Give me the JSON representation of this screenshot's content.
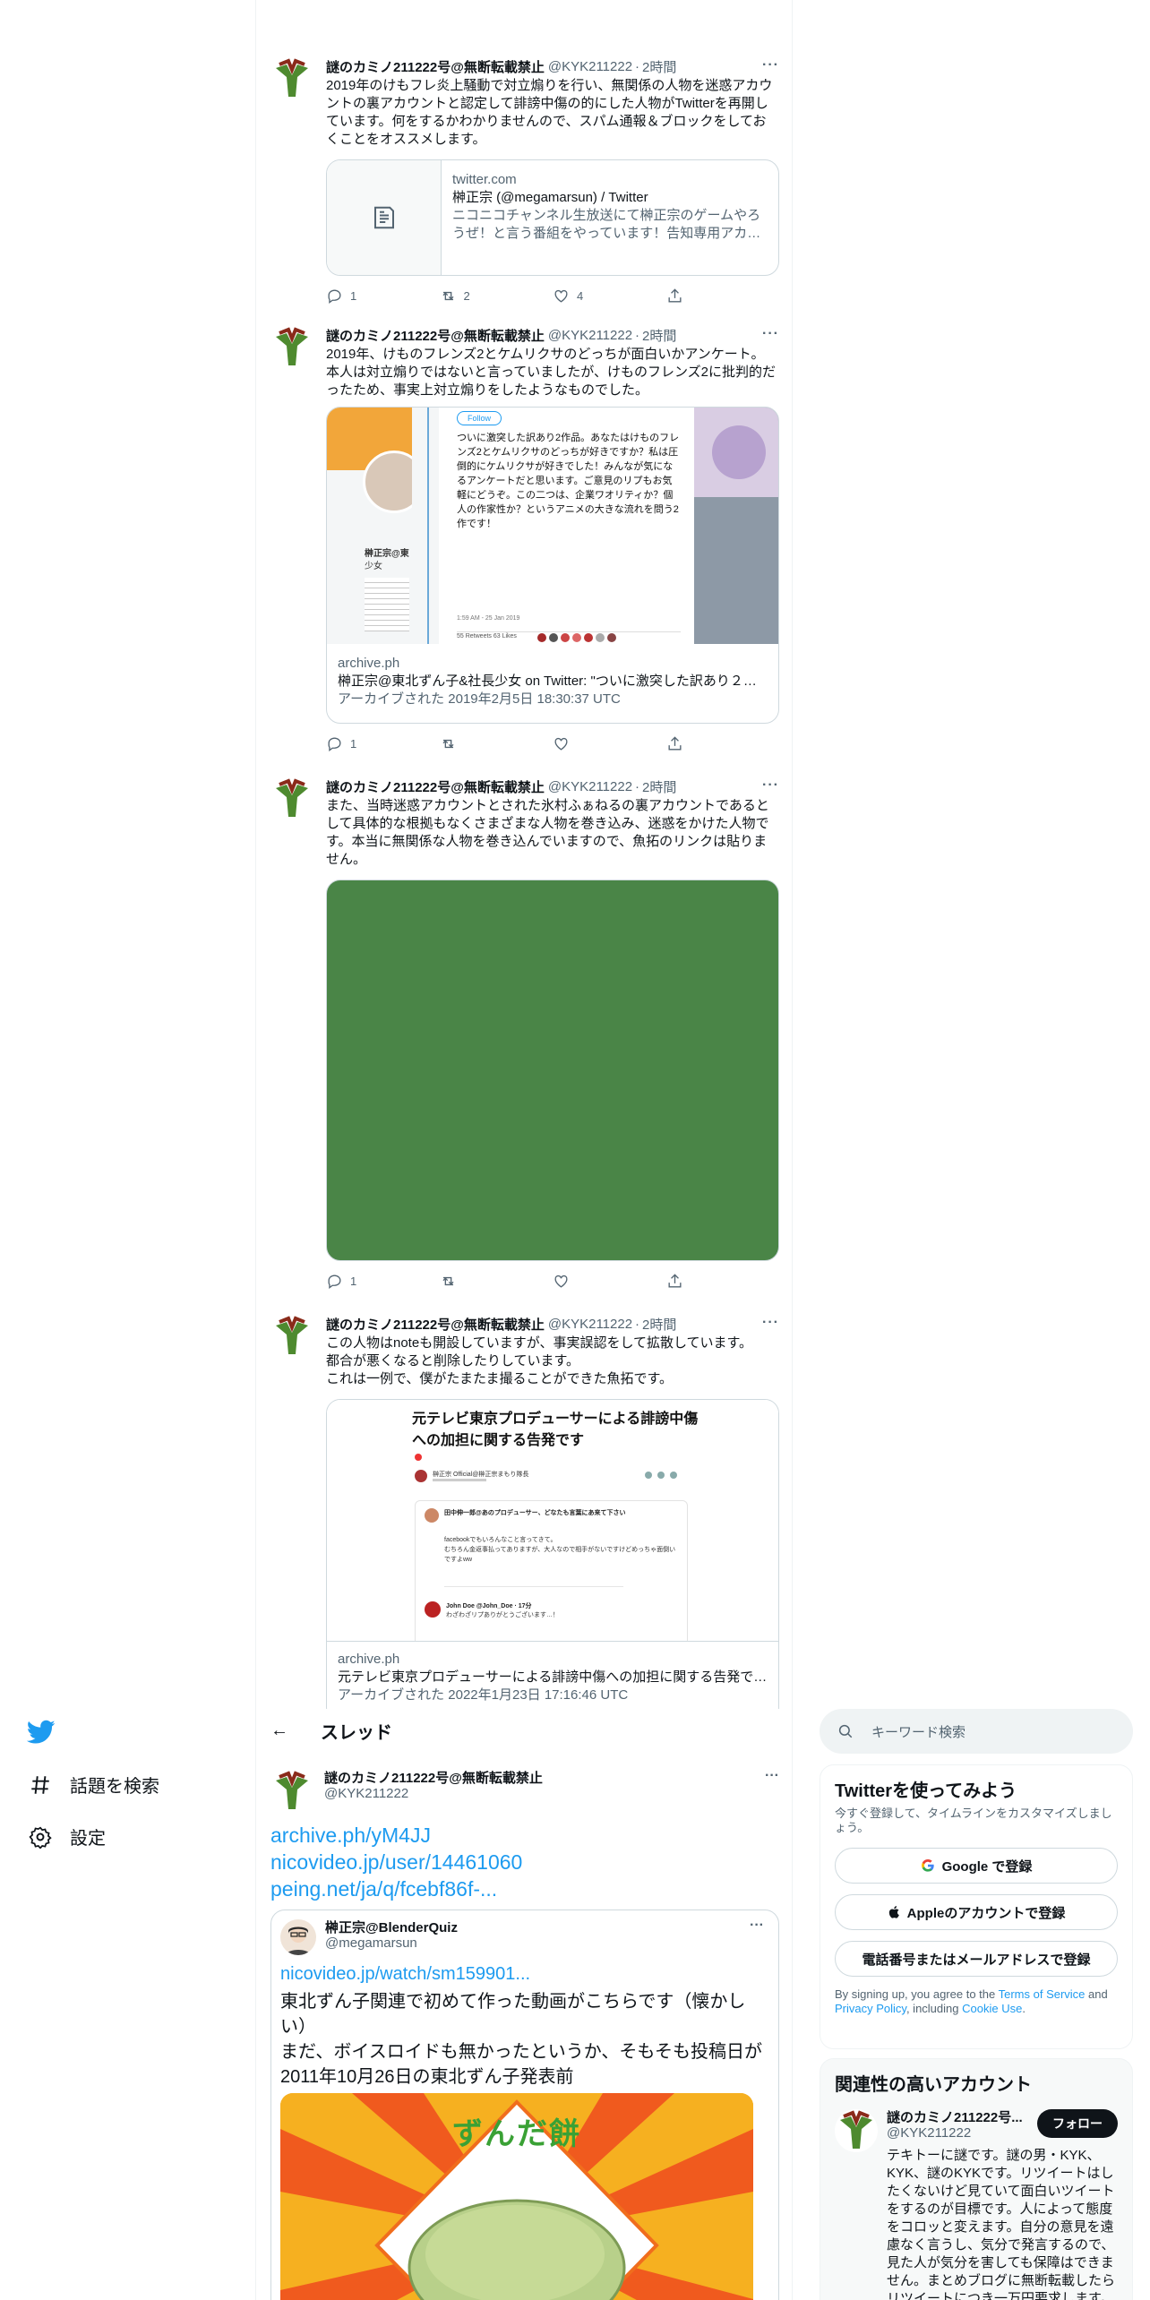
{
  "tweets": [
    {
      "name": "謎のカミノ211222号@無断転載禁止",
      "handle": "@KYK211222",
      "time": "2時間",
      "text": "2019年のけもフレ炎上騒動で対立煽りを行い、無関係の人物を迷惑アカウントの裏アカウントと認定して誹謗中傷の的にした人物がTwitterを再開しています。何をするかわかりませんので、スパム通報＆ブロックをしておくことをオススメします。",
      "card": {
        "domain": "twitter.com",
        "title": "榊正宗 (@megamarsun) / Twitter",
        "desc": "ニコニコチャンネル生放送にて榊正宗のゲームやろうぜ！と言う番組をやっています！告知専用アカウント"
      },
      "actions": {
        "reply": "1",
        "retweet": "2",
        "like": "4"
      }
    },
    {
      "name": "謎のカミノ211222号@無断転載禁止",
      "handle": "@KYK211222",
      "time": "2時間",
      "text": "2019年、けものフレンズ2とケムリクサのどっちが面白いかアンケート。\n本人は対立煽りではないと言っていましたが、けものフレンズ2に批判的だったため、事実上対立煽りをしたようなものでした。",
      "card": {
        "embed_follow": "Follow",
        "embed_text": "ついに激突した訳あり2作品。あなたはけものフレンズ2とケムリクサのどっちが好きですか？私は圧倒的にケムリクサが好きでした！みんなが気になるアンケートだと思います。ご意見のリプもお気軽にどうぞ。この二つは、企業ワオリティか？個人の作家性か？というアニメの大きな流れを問う2作です！",
        "embed_time": "1:59 AM - 25 Jan 2019",
        "embed_stats": "55 Retweets  63 Likes",
        "left_name": "榊正宗@東",
        "left_sub": "少女",
        "domain": "archive.ph",
        "title": "榊正宗@東北ずん子&社長少女 on Twitter: \"ついに激突した訳あり２作品。あなたはけものフレンズ2とケムリクサのどっちが好きですか？",
        "archived": "アーカイブされた 2019年2月5日 18:30:37 UTC"
      },
      "actions": {
        "reply": "1",
        "retweet": "",
        "like": ""
      }
    },
    {
      "name": "謎のカミノ211222号@無断転載禁止",
      "handle": "@KYK211222",
      "time": "2時間",
      "text": "また、当時迷惑アカウントとされた氷村ふぁねるの裏アカウントであるとして具体的な根拠もなくさまざまな人物を巻き込み、迷惑をかけた人物です。本当に無関係な人物を巻き込んでいますので、魚拓のリンクは貼りません。",
      "media_color": "#4a8547",
      "actions": {
        "reply": "1",
        "retweet": "",
        "like": ""
      }
    },
    {
      "name": "謎のカミノ211222号@無断転載禁止",
      "handle": "@KYK211222",
      "time": "2時間",
      "text": "この人物はnoteも開設していますが、事実誤認をして拡散しています。\n都合が悪くなると削除したりしています。\nこれは一例で、僕がたまたま撮ることができた魚拓です。",
      "card": {
        "shot_title": "元テレビ東京プロデューサーによる誹謗中傷への加担に関する告発です",
        "shot_author": "榊正宗 Official@榊正宗まもり隊長",
        "shot_reply_name": "田中伸一郎@あのプロデューサー、どなたも言葉にあ来て下さい",
        "shot_reply_text": "facebookでもいろんなこと言ってきて。\nむちろん金返事払ってありますが、大人なので相手がないですけどめっちゃ面倒いですよww",
        "shot_reply2": "John Doe @John_Doe · 17分",
        "shot_reply2_text": "わざわざリプありがとうございます…！",
        "domain": "archive.ph",
        "title": "元テレビ東京プロデューサーによる誹謗中傷への加担に関する告発です｜榊正宗 Official@",
        "archived": "アーカイブされた 2022年1月23日 17:16:46 UTC"
      }
    }
  ],
  "nav": {
    "explore_label": "話題を検索",
    "settings_label": "設定"
  },
  "header": {
    "back": "←",
    "title": "スレッド"
  },
  "main_tweet": {
    "name": "謎のカミノ211222号@無断転載禁止",
    "handle": "@KYK211222",
    "links": [
      "archive.ph/yM4JJ",
      "nicovideo.jp/user/14461060",
      "peing.net/ja/q/fcebf86f-..."
    ],
    "quote": {
      "name": "榊正宗@BlenderQuiz",
      "handle": "@megamarsun",
      "link": "nicovideo.jp/watch/sm159901...",
      "text": "東北ずん子関連で初めて作った動画がこちらです（懐かしい）\nまだ、ボイスロイドも無かったというか、そもそも投稿日が2011年10月26日の東北ずん子発表前",
      "image_text": "ずんだ餅"
    }
  },
  "search": {
    "placeholder": "キーワード検索"
  },
  "signup": {
    "title": "Twitterを使ってみよう",
    "sub": "今すぐ登録して、タイムラインをカスタマイズしましょう。",
    "google": "Google で登録",
    "apple": "Appleのアカウントで登録",
    "phone": "電話番号またはメールアドレスで登録",
    "terms_1": "By signing up, you agree to the ",
    "terms_link": "Terms of Service",
    "terms_2": " and ",
    "privacy_link": "Privacy Policy",
    "terms_3": ", including ",
    "cookie_link": "Cookie Use",
    "terms_4": "."
  },
  "related": {
    "title": "関連性の高いアカウント",
    "name": "謎のカミノ211222号...",
    "handle": "@KYK211222",
    "follow": "フォロー",
    "bio": "テキトーに謎です。謎の男・KYK、KYK、謎のKYKです。リツイートはしたくないけど見ていて面白いツイートをするのが目標です。人によって態度をコロッと変えます。自分の意見を遠慮なく言うし、気分で発言するので、見た人が気分を害しても保障はできません。まとめブログに無断転載したらリツイートにつき一万円要求します。"
  },
  "colors": {
    "accent": "#1d9bf0",
    "text": "#0f1419",
    "muted": "#536471",
    "border": "#cfd9de"
  }
}
